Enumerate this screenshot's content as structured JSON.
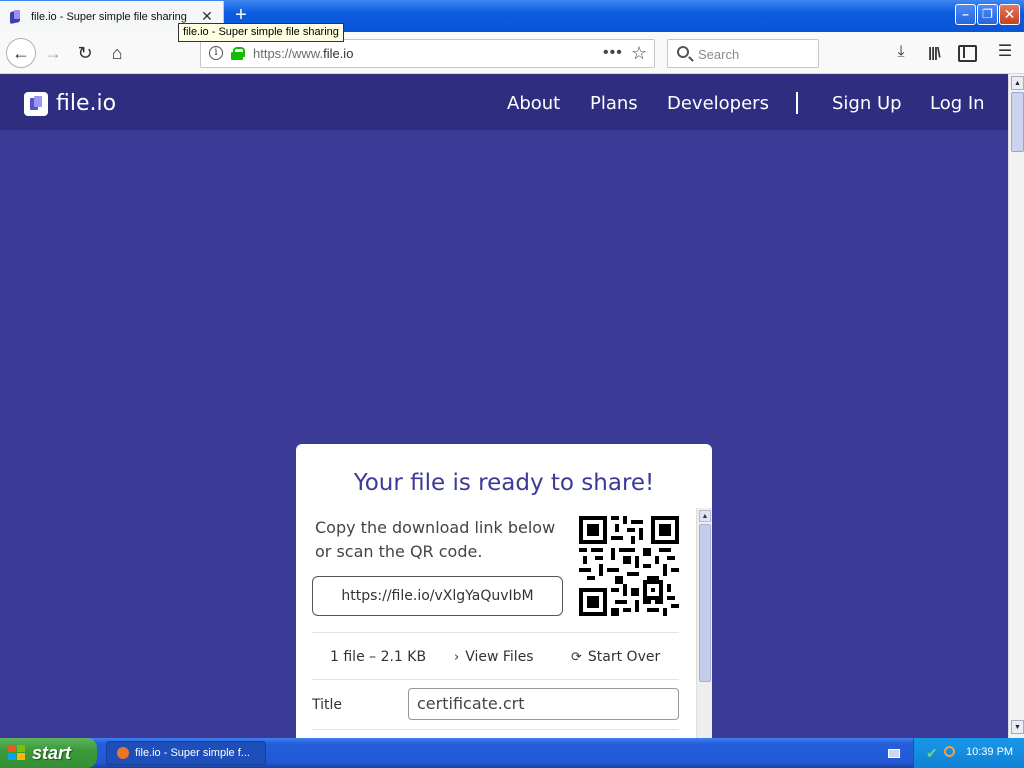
{
  "browser": {
    "tab_title": "file.io - Super simple file sharing",
    "tooltip": "file.io - Super simple file sharing",
    "url_prefix": "https://www.",
    "url_domain": "file.io",
    "search_placeholder": "Search",
    "icons": [
      "back-arrow-icon",
      "forward-arrow-icon",
      "reload-icon",
      "home-icon",
      "info-icon",
      "lock-icon",
      "page-actions-icon",
      "bookmark-star-icon",
      "search-icon",
      "downloads-icon",
      "library-icon",
      "sidebar-icon",
      "hamburger-menu-icon"
    ]
  },
  "site": {
    "brand": "file.io",
    "nav": {
      "about": "About",
      "plans": "Plans",
      "developers": "Developers",
      "signup": "Sign Up",
      "login": "Log In"
    },
    "colors": {
      "background": "#3b3a97",
      "header": "#2e2d80",
      "accent": "#3b3a97"
    }
  },
  "share": {
    "heading": "Your file is ready to share!",
    "description": "Copy the download link below or scan the QR code.",
    "link": "https://file.io/vXlgYaQuvIbM",
    "file_summary": "1 file – 2.1 KB",
    "view_files": "View Files",
    "start_over": "Start Over",
    "title_label": "Title",
    "title_value": "certificate.crt"
  },
  "taskbar": {
    "start_label": "start",
    "task_label": "file.io - Super simple f...",
    "clock": "10:39 PM"
  }
}
